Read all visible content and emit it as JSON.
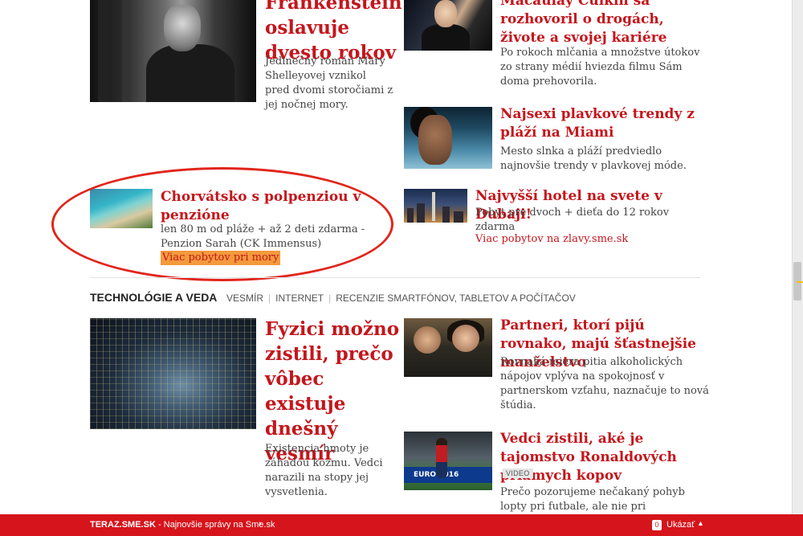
{
  "articles": {
    "frankenstein": {
      "title": "Frankenštein oslavuje dvesto rokov",
      "desc": "Jedinečný román Mary Shelleyovej vznikol pred dvomi storočiami z jej nočnej mory."
    },
    "culkin": {
      "title": "Macaulay Culkin sa rozhovoril o drogách, živote a svojej kariére",
      "desc": "Po rokoch mlčania a množstve útokov zo strany médií hviezda filmu Sám doma prehovorila."
    },
    "swimwear": {
      "title": "Najsexi plavkové trendy z pláží na Miami",
      "desc": "Mesto slnka a pláží predviedlo najnovšie trendy v plavkovej móde."
    },
    "dubai": {
      "title": "Najvyšší hotel na svete v Dubaji!",
      "desc": "Pobyt pre dvoch + dieťa do 12 rokov zdarma",
      "link": "Viac pobytov na zlavy.sme.sk"
    },
    "croatia": {
      "title": "Chorvátsko s polpenziou v penzióne",
      "desc": "len 80 m od pláže + až 2 deti zdarma - Penzion Sarah (CK Immensus)",
      "link": "Viac pobytov pri mory"
    },
    "physics": {
      "title": "Fyzici možno zistili, prečo vôbec existuje dnešný vesmír",
      "desc": "Existencia hmoty je záhadou kozmu. Vedci narazili na stopy jej vysvetlenia."
    },
    "drinking": {
      "title": "Partneri, ktorí pijú rovnako, majú šťastnejšie manželstvo",
      "desc": "Rovnaká miera pitia alkoholických nápojov vplýva na spokojnosť v partnerskom vzťahu, naznačuje to nová štúdia."
    },
    "ronaldo": {
      "title": "Vedci zistili, aké je tajomstvo Ronaldových priamych kopov",
      "badge": "VIDEO",
      "desc": "Prečo pozorujeme nečakaný pohyb lopty pri futbale, ale nie pri",
      "image_text": "EURO 2016"
    }
  },
  "section": {
    "title": "TECHNOLÓGIE A VEDA",
    "links": [
      "VESMÍR",
      "INTERNET",
      "RECENZIE SMARTFÓNOV, TABLETOV A POČÍTAČOV"
    ]
  },
  "bottom_bar": {
    "brand": "TERAZ.SME.SK",
    "text": " - Najnovšie správy na Sme.sk",
    "arrow": "›",
    "count": "0",
    "show_label": "Ukázať",
    "caret": "▲"
  },
  "colors": {
    "accent": "#c4161c",
    "bar": "#d6141b",
    "highlight": "#f39a3c",
    "annotation": "#e1251b"
  }
}
